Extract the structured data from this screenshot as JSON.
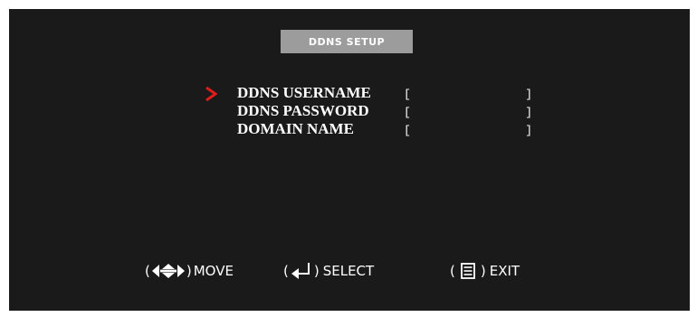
{
  "title": "DDNS SETUP",
  "fields": [
    {
      "label": "DDNS USERNAME",
      "value": ""
    },
    {
      "label": "DDNS PASSWORD",
      "value": ""
    },
    {
      "label": "DOMAIN NAME",
      "value": ""
    }
  ],
  "selected_field": "DDNS USERNAME",
  "footer": {
    "move": {
      "icon": "arrows-icon",
      "label": "MOVE"
    },
    "select": {
      "icon": "enter-icon",
      "label": "SELECT"
    },
    "exit": {
      "icon": "menu-icon",
      "label": "EXIT"
    }
  },
  "colors": {
    "background": "#1a1a1a",
    "title_bar": "#9c9c9c",
    "cursor": "#e21b1b",
    "text": "#ffffff"
  }
}
